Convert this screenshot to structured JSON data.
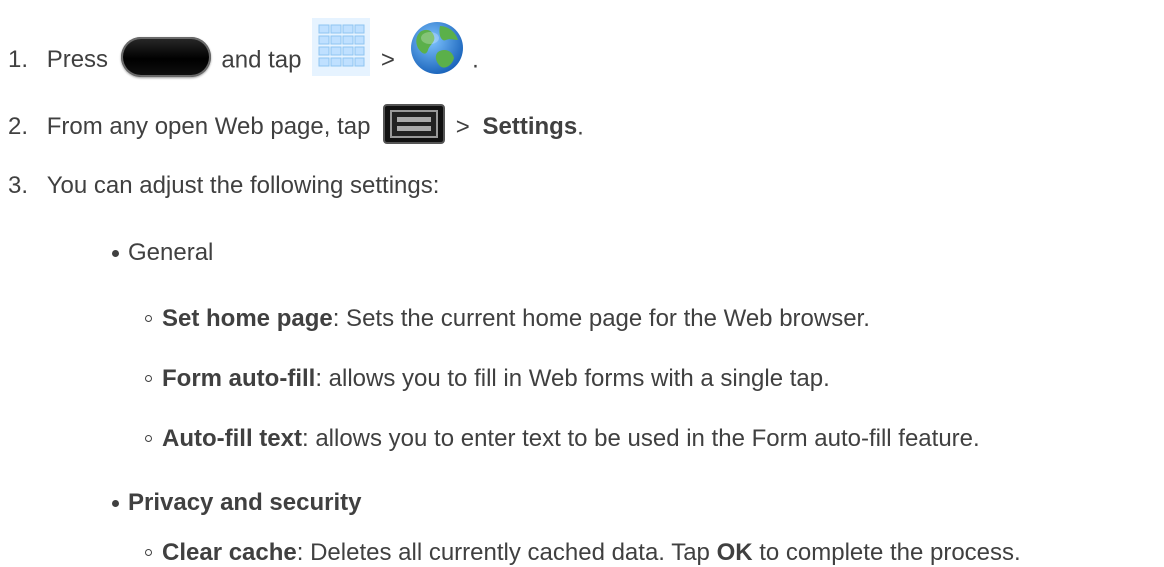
{
  "steps": [
    {
      "number": "1.",
      "text_press": "Press",
      "home_key_icon": "home-key-icon",
      "text_and_tap": "and tap",
      "apps_icon": "apps-grid-icon",
      "sep": ">",
      "browser_icon": "globe-browser-icon",
      "end": "."
    },
    {
      "number": "2.",
      "text_before": "From any open Web page, tap",
      "menu_key_icon": "menu-key-icon",
      "sep": ">",
      "bold": "Settings",
      "end": "."
    },
    {
      "number": "3.",
      "text": "You can adjust the following settings:"
    }
  ],
  "sections": [
    {
      "label": "General",
      "items": [
        {
          "term": "Set home page",
          "desc": ": Sets the current home page for the Web browser."
        },
        {
          "term": "Form auto-fill",
          "desc": ": allows you to fill in Web forms with a single tap."
        },
        {
          "term": "Auto-fill text",
          "desc": ": allows you to enter text to be used in the Form auto-fill feature."
        }
      ]
    },
    {
      "label": "Privacy and security",
      "items": [
        {
          "term": "Clear cache",
          "desc_before": ": Deletes all currently cached data. Tap ",
          "bold_mid": "OK",
          "desc_after": " to complete the process."
        }
      ]
    }
  ],
  "colors": {
    "text": "#404040",
    "apps_icon": "#bfe0ff",
    "globe_ocean": "#2a86d8",
    "globe_land": "#5bb04a"
  }
}
